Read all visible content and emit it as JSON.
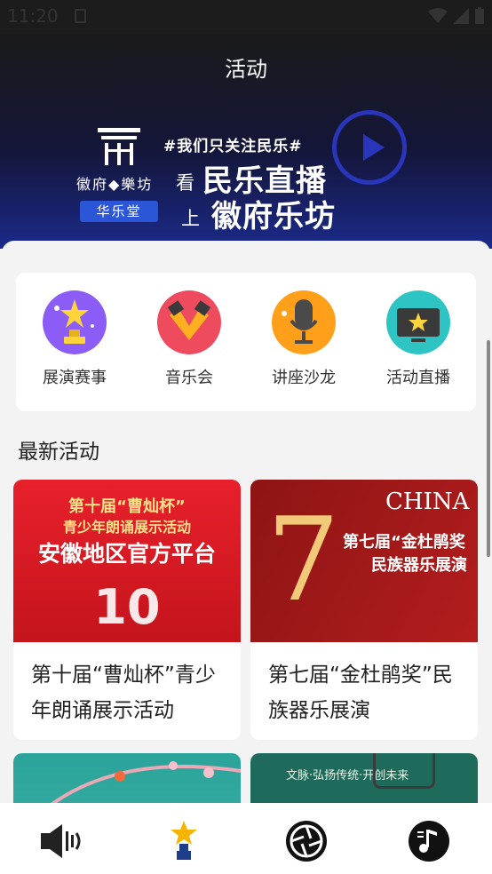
{
  "status": {
    "time": "11:20"
  },
  "page": {
    "title": "活动"
  },
  "banner": {
    "tagline": "#我们只关注民乐#",
    "kan": "看",
    "shang": "上",
    "main_line1": "民乐直播",
    "main_line2": "徽府乐坊",
    "logo_text": "徽府◆樂坊",
    "logo_badge": "华乐堂"
  },
  "categories": [
    {
      "label": "展演赛事",
      "icon": "trophy-icon",
      "color": "#8b5cf6"
    },
    {
      "label": "音乐会",
      "icon": "spotlight-icon",
      "color": "#ef4b5e"
    },
    {
      "label": "讲座沙龙",
      "icon": "microphone-icon",
      "color": "#ff9f1a"
    },
    {
      "label": "活动直播",
      "icon": "tv-star-icon",
      "color": "#2ec4c4"
    }
  ],
  "section": {
    "latest_title": "最新活动"
  },
  "activities": [
    {
      "title": "第十届“曹灿杯”青少年朗诵展示活动",
      "poster_line1": "第十届“曹灿杯”",
      "poster_line2": "青少年朗诵展示活动",
      "poster_line3": "安徽地区官方平台",
      "poster_number": "10"
    },
    {
      "title": "第七届“金杜鹃奖”民族器乐展演",
      "poster_header": "CHINA",
      "poster_line1": "第七届“金杜鹃奖",
      "poster_line2": "民族器乐展演",
      "poster_number": "7"
    },
    {
      "title": "",
      "poster_text": ""
    },
    {
      "title": "",
      "poster_text": "文脉·弘扬传统·开创未来"
    }
  ],
  "tabs": [
    {
      "name": "speaker-tab",
      "icon": "speaker-icon"
    },
    {
      "name": "activity-tab",
      "icon": "star-tower-icon"
    },
    {
      "name": "shutter-tab",
      "icon": "aperture-icon"
    },
    {
      "name": "music-tab",
      "icon": "music-note-icon"
    }
  ]
}
